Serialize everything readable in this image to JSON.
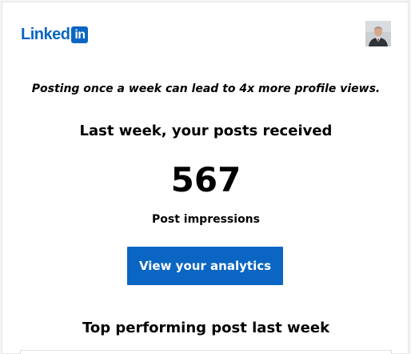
{
  "brand": {
    "logo_text": "Linked",
    "logo_box_text": "in",
    "color": "#0a66c2"
  },
  "avatar": {
    "icon": "profile-photo"
  },
  "email": {
    "tip": "Posting once a week can lead to 4x more profile views.",
    "subheading": "Last week, your posts received",
    "impressions_value": "567",
    "impressions_label": "Post impressions",
    "cta_label": "View your analytics",
    "section_title": "Top performing post last week"
  }
}
